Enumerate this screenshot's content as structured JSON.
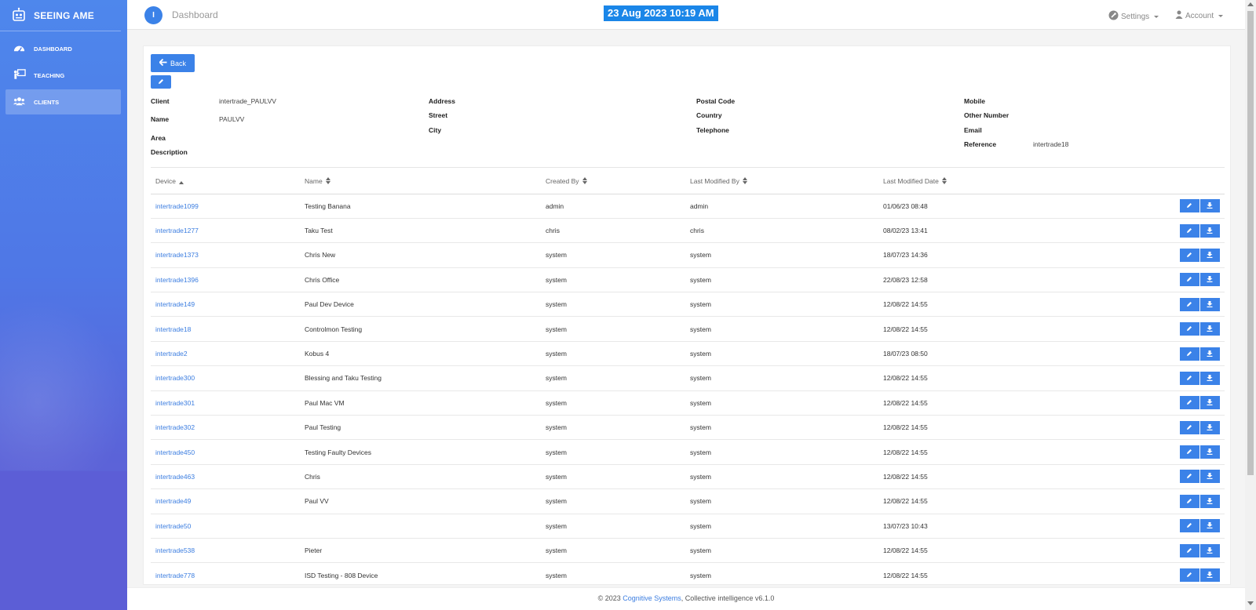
{
  "app": {
    "title": "SEEING AME"
  },
  "sidebar": {
    "items": [
      {
        "label": "DASHBOARD",
        "icon": "dashboard-gauge-icon"
      },
      {
        "label": "TEACHING",
        "icon": "teaching-board-icon"
      },
      {
        "label": "CLIENTS",
        "icon": "users-icon",
        "active": true
      }
    ]
  },
  "header": {
    "circle_label": "I",
    "breadcrumb": "Dashboard",
    "datetime": "23 Aug 2023 10:19 AM",
    "settings_label": "Settings",
    "account_label": "Account"
  },
  "actions": {
    "back_label": "Back"
  },
  "client": {
    "labels": {
      "client": "Client",
      "name": "Name",
      "area": "Area",
      "description": "Description",
      "address": "Address",
      "street": "Street",
      "city": "City",
      "postal_code": "Postal Code",
      "country": "Country",
      "telephone": "Telephone",
      "mobile": "Mobile",
      "other_number": "Other Number",
      "email": "Email",
      "reference": "Reference"
    },
    "values": {
      "client": "intertrade_PAULVV",
      "name": "PAULVV",
      "reference": "intertrade18"
    }
  },
  "table": {
    "headers": {
      "device": "Device",
      "name": "Name",
      "created_by": "Created By",
      "last_modified_by": "Last Modified By",
      "last_modified_date": "Last Modified Date"
    },
    "rows": [
      {
        "device": "intertrade1099",
        "name": "Testing Banana",
        "created_by": "admin",
        "modified_by": "admin",
        "modified_date": "01/06/23 08:48"
      },
      {
        "device": "intertrade1277",
        "name": "Taku Test",
        "created_by": "chris",
        "modified_by": "chris",
        "modified_date": "08/02/23 13:41"
      },
      {
        "device": "intertrade1373",
        "name": "Chris New",
        "created_by": "system",
        "modified_by": "system",
        "modified_date": "18/07/23 14:36"
      },
      {
        "device": "intertrade1396",
        "name": "Chris Office",
        "created_by": "system",
        "modified_by": "system",
        "modified_date": "22/08/23 12:58"
      },
      {
        "device": "intertrade149",
        "name": "Paul Dev Device",
        "created_by": "system",
        "modified_by": "system",
        "modified_date": "12/08/22 14:55"
      },
      {
        "device": "intertrade18",
        "name": "Controlmon Testing",
        "created_by": "system",
        "modified_by": "system",
        "modified_date": "12/08/22 14:55"
      },
      {
        "device": "intertrade2",
        "name": "Kobus 4",
        "created_by": "system",
        "modified_by": "system",
        "modified_date": "18/07/23 08:50"
      },
      {
        "device": "intertrade300",
        "name": "Blessing and Taku Testing",
        "created_by": "system",
        "modified_by": "system",
        "modified_date": "12/08/22 14:55"
      },
      {
        "device": "intertrade301",
        "name": "Paul Mac VM",
        "created_by": "system",
        "modified_by": "system",
        "modified_date": "12/08/22 14:55"
      },
      {
        "device": "intertrade302",
        "name": "Paul Testing",
        "created_by": "system",
        "modified_by": "system",
        "modified_date": "12/08/22 14:55"
      },
      {
        "device": "intertrade450",
        "name": "Testing Faulty Devices",
        "created_by": "system",
        "modified_by": "system",
        "modified_date": "12/08/22 14:55"
      },
      {
        "device": "intertrade463",
        "name": "Chris",
        "created_by": "system",
        "modified_by": "system",
        "modified_date": "12/08/22 14:55"
      },
      {
        "device": "intertrade49",
        "name": "Paul VV",
        "created_by": "system",
        "modified_by": "system",
        "modified_date": "12/08/22 14:55"
      },
      {
        "device": "intertrade50",
        "name": "",
        "created_by": "system",
        "modified_by": "system",
        "modified_date": "13/07/23 10:43"
      },
      {
        "device": "intertrade538",
        "name": "Pieter",
        "created_by": "system",
        "modified_by": "system",
        "modified_date": "12/08/22 14:55"
      },
      {
        "device": "intertrade778",
        "name": "ISD Testing - 808 Device",
        "created_by": "system",
        "modified_by": "system",
        "modified_date": "12/08/22 14:55"
      }
    ]
  },
  "footer": {
    "prefix": "© 2023 ",
    "link": "Cognitive Systems",
    "suffix": ", Collective intelligence v6.1.0"
  },
  "colors": {
    "primary": "#3b82e8",
    "sidebar_top": "#4e87ec",
    "sidebar_bottom": "#6660d6",
    "link": "#3b7de0"
  }
}
